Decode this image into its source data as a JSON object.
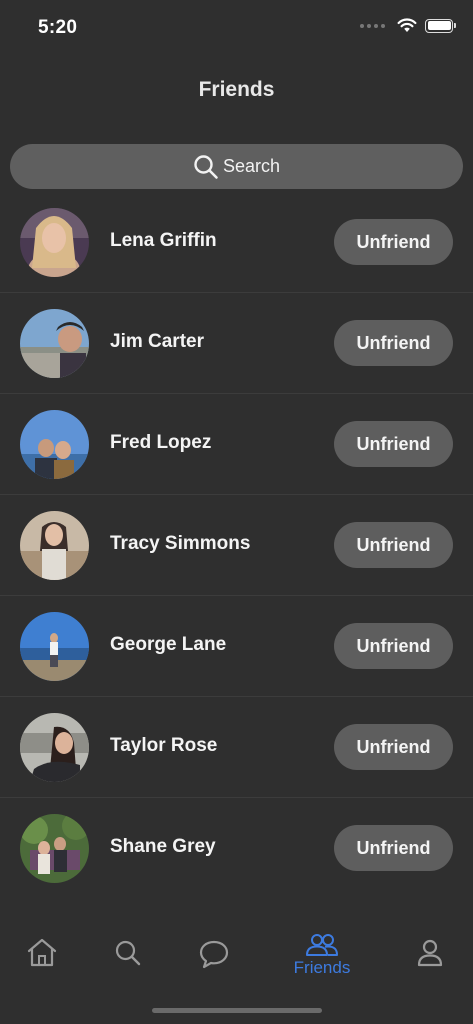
{
  "status_bar": {
    "time": "5:20"
  },
  "header": {
    "title": "Friends"
  },
  "search": {
    "label": "Search"
  },
  "friends": [
    {
      "name": "Lena Griffin",
      "action": "Unfriend"
    },
    {
      "name": "Jim Carter",
      "action": "Unfriend"
    },
    {
      "name": "Fred Lopez",
      "action": "Unfriend"
    },
    {
      "name": "Tracy Simmons",
      "action": "Unfriend"
    },
    {
      "name": "George Lane",
      "action": "Unfriend"
    },
    {
      "name": "Taylor Rose",
      "action": "Unfriend"
    },
    {
      "name": "Shane Grey",
      "action": "Unfriend"
    }
  ],
  "tab_bar": {
    "items": [
      {
        "icon": "home-icon",
        "label": ""
      },
      {
        "icon": "search-icon",
        "label": ""
      },
      {
        "icon": "chat-bubble-icon",
        "label": ""
      },
      {
        "icon": "friends-icon",
        "label": "Friends",
        "active": true
      },
      {
        "icon": "profile-icon",
        "label": ""
      }
    ],
    "active_color": "#3d7be0",
    "inactive_color": "#9a9a9a"
  },
  "colors": {
    "background": "#2f2f2f",
    "pill": "#5e5e5e",
    "text": "#f4f4f4"
  }
}
